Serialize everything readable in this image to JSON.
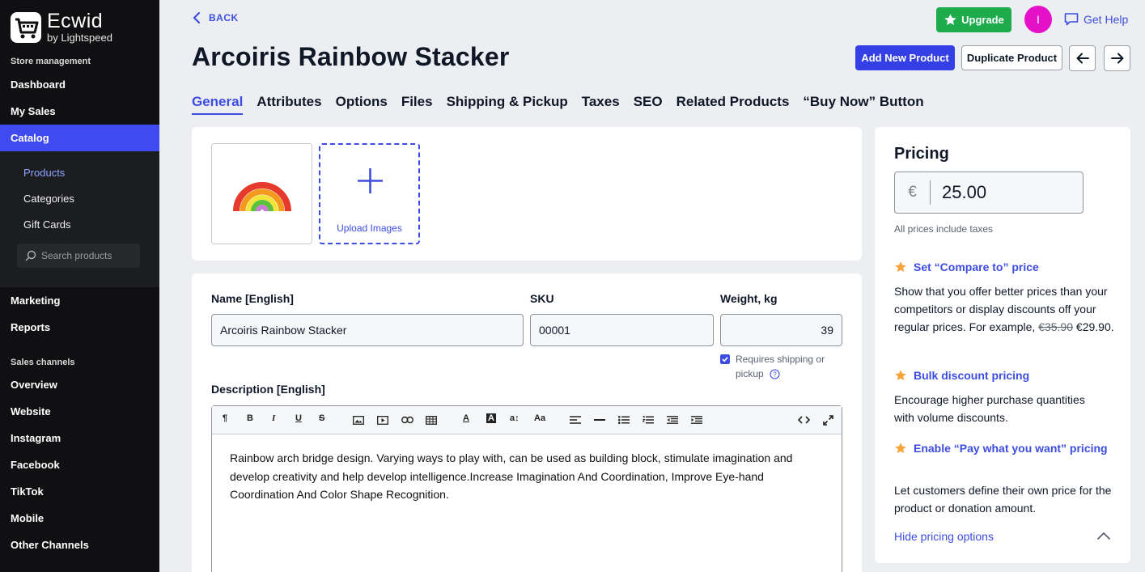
{
  "colors": {
    "accent": "#3d4de0",
    "primary_button": "#3440e6",
    "upgrade_green": "#1dab4c",
    "sidebar_bg": "#101012",
    "avatar_pink": "#e411c8"
  },
  "brand": {
    "title": "Ecwid",
    "subtitle": "by Lightspeed"
  },
  "sidebar": {
    "store_management_label": "Store management",
    "items_top": [
      "Dashboard",
      "My Sales",
      "Catalog"
    ],
    "catalog_sub": [
      "Products",
      "Categories",
      "Gift Cards"
    ],
    "search_placeholder": "Search products",
    "items_mid": [
      "Marketing",
      "Reports"
    ],
    "sales_channels_label": "Sales channels",
    "channels": [
      "Overview",
      "Website",
      "Instagram",
      "Facebook",
      "TikTok",
      "Mobile",
      "Other Channels"
    ]
  },
  "header": {
    "back_label": "BACK",
    "title": "Arcoiris Rainbow Stacker",
    "upgrade_label": "Upgrade",
    "avatar_initial": "I",
    "help_label": "Get Help",
    "add_new_label": "Add New Product",
    "duplicate_label": "Duplicate Product"
  },
  "tabs": [
    "General",
    "Attributes",
    "Options",
    "Files",
    "Shipping & Pickup",
    "Taxes",
    "SEO",
    "Related Products",
    "“Buy Now” Button"
  ],
  "images": {
    "upload_label": "Upload Images"
  },
  "form": {
    "name_label": "Name [English]",
    "name_value": "Arcoiris Rainbow Stacker",
    "sku_label": "SKU",
    "sku_value": "00001",
    "weight_label": "Weight, kg",
    "weight_value": "39",
    "requires_shipping_line1": "Requires shipping or",
    "requires_shipping_line2": "pickup",
    "description_label": "Description [English]",
    "description_text": "Rainbow arch bridge design. Varying ways to play with, can be used as building block, stimulate imagination and develop creativity and help develop intelligence.Increase Imagination And Coordination, Improve Eye-hand Coordination And Color Shape Recognition."
  },
  "pricing": {
    "title": "Pricing",
    "currency": "€",
    "price": "25.00",
    "note": "All prices include taxes",
    "compare_title": "Set “Compare to” price",
    "compare_text": "Show that you offer better prices than your competitors or display discounts off your regular prices. For example,",
    "compare_old": "€35.90",
    "compare_new": "€29.90.",
    "bulk_title": "Bulk discount pricing",
    "bulk_text": "Encourage higher purchase quantities with volume discounts.",
    "pwyw_title": "Enable “Pay what you want” pricing",
    "pwyw_text": "Let customers define their own price for the product or donation amount.",
    "hide_label": "Hide pricing options"
  }
}
